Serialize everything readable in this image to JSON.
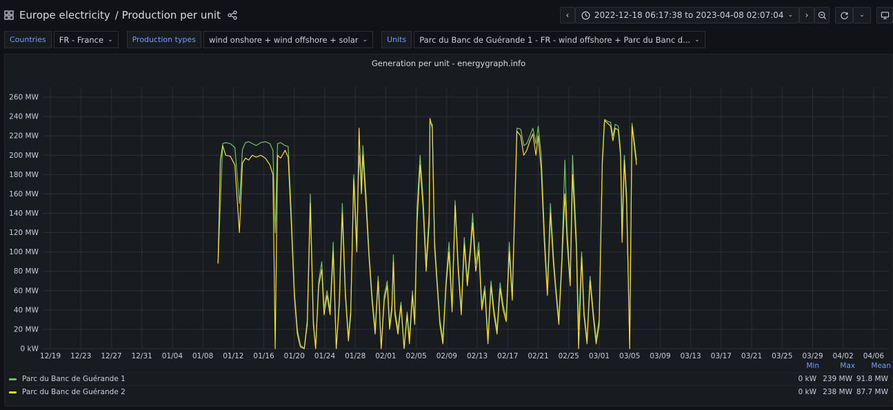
{
  "header": {
    "title": "Europe electricity",
    "subtitle": "/ Production per unit"
  },
  "time_picker": {
    "range": "2022-12-18 06:17:38 to 2023-04-08 02:07:04"
  },
  "variables": [
    {
      "label": "Countries",
      "value": "FR - France"
    },
    {
      "label": "Production types",
      "value": "wind onshore + wind offshore + solar"
    },
    {
      "label": "Units",
      "value": "Parc du Banc de Guérande 1 - FR - wind offshore + Parc du Banc d..."
    }
  ],
  "icons": {
    "grid": "dashboard-grid-icon",
    "share": "share-icon",
    "clock": "clock-icon",
    "zoom": "zoom-out-icon",
    "refresh": "refresh-icon",
    "monitor": "monitor-icon"
  },
  "colors": {
    "series1": "#73bf69",
    "series2": "#fade2a",
    "accent": "#6e9fff",
    "grid": "#2c2f36",
    "panel_bg": "#181b1f"
  },
  "chart_data": {
    "type": "line",
    "title": "Generation per unit - energygraph.info",
    "xlabel": "",
    "ylabel": "",
    "x_ticks": [
      "12/19",
      "12/23",
      "12/27",
      "12/31",
      "01/04",
      "01/08",
      "01/12",
      "01/16",
      "01/20",
      "01/24",
      "01/28",
      "02/01",
      "02/05",
      "02/09",
      "02/13",
      "02/17",
      "02/21",
      "02/25",
      "03/01",
      "03/05",
      "03/09",
      "03/13",
      "03/17",
      "03/21",
      "03/25",
      "03/29",
      "04/02",
      "04/06"
    ],
    "y_ticks": [
      "0 kW",
      "20 MW",
      "40 MW",
      "60 MW",
      "80 MW",
      "100 MW",
      "120 MW",
      "140 MW",
      "160 MW",
      "180 MW",
      "200 MW",
      "220 MW",
      "240 MW",
      "260 MW"
    ],
    "ylim": [
      0,
      270
    ],
    "x_range_days": [
      0,
      111
    ],
    "legend_columns": [
      "Min",
      "Max",
      "Mean"
    ],
    "grid": true,
    "legend_position": "bottom",
    "series": [
      {
        "name": "Parc du Banc de Guérande 1",
        "color": "#73bf69",
        "stats": {
          "min": "0 kW",
          "max": "239 MW",
          "mean": "91.8 MW"
        },
        "points": [
          [
            23.0,
            88
          ],
          [
            23.3,
            150
          ],
          [
            23.6,
            212
          ],
          [
            24.0,
            213
          ],
          [
            24.6,
            212
          ],
          [
            25.2,
            208
          ],
          [
            25.8,
            150
          ],
          [
            26.2,
            206
          ],
          [
            26.6,
            213
          ],
          [
            27.0,
            214
          ],
          [
            27.5,
            212
          ],
          [
            28.0,
            210
          ],
          [
            28.6,
            213
          ],
          [
            29.2,
            214
          ],
          [
            29.8,
            212
          ],
          [
            30.2,
            205
          ],
          [
            30.5,
            120
          ],
          [
            30.8,
            212
          ],
          [
            31.2,
            213
          ],
          [
            31.8,
            210
          ],
          [
            32.2,
            209
          ],
          [
            32.6,
            140
          ],
          [
            33.0,
            60
          ],
          [
            33.4,
            20
          ],
          [
            33.8,
            4
          ],
          [
            34.3,
            0
          ],
          [
            34.7,
            30
          ],
          [
            35.1,
            160
          ],
          [
            35.5,
            30
          ],
          [
            35.8,
            0
          ],
          [
            36.2,
            70
          ],
          [
            36.6,
            90
          ],
          [
            36.9,
            42
          ],
          [
            37.3,
            60
          ],
          [
            37.7,
            40
          ],
          [
            38.1,
            110
          ],
          [
            38.5,
            0
          ],
          [
            38.9,
            50
          ],
          [
            39.3,
            150
          ],
          [
            39.7,
            60
          ],
          [
            40.1,
            12
          ],
          [
            40.4,
            40
          ],
          [
            40.8,
            180
          ],
          [
            41.2,
            110
          ],
          [
            41.5,
            200
          ],
          [
            41.8,
            170
          ],
          [
            42.0,
            210
          ],
          [
            42.4,
            160
          ],
          [
            42.8,
            100
          ],
          [
            43.2,
            55
          ],
          [
            43.6,
            20
          ],
          [
            44.0,
            75
          ],
          [
            44.4,
            0
          ],
          [
            44.8,
            55
          ],
          [
            45.2,
            70
          ],
          [
            45.5,
            25
          ],
          [
            45.8,
            45
          ],
          [
            46.0,
            97
          ],
          [
            46.2,
            40
          ],
          [
            46.6,
            20
          ],
          [
            47.0,
            48
          ],
          [
            47.4,
            0
          ],
          [
            47.8,
            38
          ],
          [
            48.1,
            10
          ],
          [
            48.5,
            60
          ],
          [
            48.8,
            28
          ],
          [
            49.1,
            145
          ],
          [
            49.5,
            200
          ],
          [
            49.9,
            155
          ],
          [
            50.3,
            88
          ],
          [
            50.7,
            140
          ],
          [
            50.8,
            234
          ],
          [
            51.1,
            232
          ],
          [
            51.4,
            112
          ],
          [
            51.7,
            75
          ],
          [
            52.1,
            30
          ],
          [
            52.5,
            10
          ],
          [
            52.9,
            70
          ],
          [
            53.3,
            110
          ],
          [
            53.7,
            42
          ],
          [
            54.1,
            153
          ],
          [
            54.5,
            88
          ],
          [
            54.9,
            40
          ],
          [
            55.3,
            115
          ],
          [
            55.7,
            70
          ],
          [
            56.1,
            105
          ],
          [
            56.4,
            140
          ],
          [
            56.8,
            88
          ],
          [
            57.2,
            110
          ],
          [
            57.6,
            45
          ],
          [
            58.0,
            65
          ],
          [
            58.4,
            10
          ],
          [
            58.8,
            70
          ],
          [
            59.2,
            40
          ],
          [
            59.6,
            20
          ],
          [
            60.0,
            68
          ],
          [
            60.4,
            45
          ],
          [
            60.8,
            32
          ],
          [
            61.2,
            110
          ],
          [
            61.6,
            55
          ],
          [
            61.9,
            142
          ],
          [
            62.2,
            228
          ],
          [
            62.7,
            227
          ],
          [
            63.1,
            210
          ],
          [
            63.5,
            212
          ],
          [
            63.9,
            220
          ],
          [
            64.3,
            228
          ],
          [
            64.7,
            212
          ],
          [
            65.0,
            230
          ],
          [
            65.4,
            200
          ],
          [
            65.8,
            120
          ],
          [
            66.2,
            60
          ],
          [
            66.6,
            150
          ],
          [
            67.0,
            95
          ],
          [
            67.3,
            65
          ],
          [
            67.7,
            30
          ],
          [
            68.1,
            95
          ],
          [
            68.5,
            195
          ],
          [
            68.8,
            120
          ],
          [
            69.2,
            70
          ],
          [
            69.5,
            200
          ],
          [
            70.0,
            115
          ],
          [
            70.3,
            20
          ],
          [
            70.7,
            100
          ],
          [
            71.0,
            40
          ],
          [
            71.4,
            9
          ],
          [
            71.8,
            75
          ],
          [
            72.2,
            40
          ],
          [
            72.6,
            10
          ],
          [
            73.0,
            30
          ],
          [
            73.4,
            195
          ],
          [
            73.7,
            237
          ],
          [
            74.1,
            235
          ],
          [
            74.5,
            234
          ],
          [
            74.8,
            220
          ],
          [
            75.1,
            232
          ],
          [
            75.5,
            230
          ],
          [
            75.8,
            205
          ],
          [
            76.0,
            125
          ],
          [
            76.3,
            200
          ],
          [
            76.6,
            160
          ],
          [
            77.0,
            0
          ],
          [
            77.3,
            233
          ],
          [
            77.6,
            215
          ],
          [
            77.9,
            195
          ]
        ]
      },
      {
        "name": "Parc du Banc de Guérande 2",
        "color": "#fade2a",
        "stats": {
          "min": "0 kW",
          "max": "238 MW",
          "mean": "87.7 MW"
        },
        "points": [
          [
            23.0,
            88
          ],
          [
            23.3,
            195
          ],
          [
            23.6,
            210
          ],
          [
            24.0,
            200
          ],
          [
            24.6,
            199
          ],
          [
            25.2,
            190
          ],
          [
            25.8,
            120
          ],
          [
            26.2,
            192
          ],
          [
            26.6,
            197
          ],
          [
            27.0,
            195
          ],
          [
            27.5,
            200
          ],
          [
            28.0,
            198
          ],
          [
            28.6,
            200
          ],
          [
            29.2,
            197
          ],
          [
            29.8,
            190
          ],
          [
            30.2,
            180
          ],
          [
            30.5,
            0
          ],
          [
            30.8,
            200
          ],
          [
            31.2,
            197
          ],
          [
            31.8,
            205
          ],
          [
            32.2,
            198
          ],
          [
            32.6,
            130
          ],
          [
            33.0,
            55
          ],
          [
            33.4,
            15
          ],
          [
            33.8,
            2
          ],
          [
            34.3,
            0
          ],
          [
            34.7,
            25
          ],
          [
            35.1,
            150
          ],
          [
            35.5,
            25
          ],
          [
            35.8,
            0
          ],
          [
            36.2,
            65
          ],
          [
            36.6,
            82
          ],
          [
            36.9,
            35
          ],
          [
            37.3,
            55
          ],
          [
            37.7,
            35
          ],
          [
            38.1,
            100
          ],
          [
            38.5,
            0
          ],
          [
            38.9,
            45
          ],
          [
            39.3,
            140
          ],
          [
            39.7,
            55
          ],
          [
            40.1,
            8
          ],
          [
            40.4,
            35
          ],
          [
            40.8,
            175
          ],
          [
            41.2,
            100
          ],
          [
            41.5,
            228
          ],
          [
            41.8,
            160
          ],
          [
            42.0,
            200
          ],
          [
            42.4,
            150
          ],
          [
            42.8,
            95
          ],
          [
            43.2,
            50
          ],
          [
            43.6,
            15
          ],
          [
            44.0,
            70
          ],
          [
            44.4,
            0
          ],
          [
            44.8,
            50
          ],
          [
            45.2,
            65
          ],
          [
            45.5,
            20
          ],
          [
            45.8,
            40
          ],
          [
            46.0,
            90
          ],
          [
            46.2,
            35
          ],
          [
            46.6,
            15
          ],
          [
            47.0,
            45
          ],
          [
            47.4,
            0
          ],
          [
            47.8,
            35
          ],
          [
            48.1,
            5
          ],
          [
            48.5,
            55
          ],
          [
            48.8,
            25
          ],
          [
            49.1,
            130
          ],
          [
            49.5,
            190
          ],
          [
            49.9,
            145
          ],
          [
            50.3,
            80
          ],
          [
            50.7,
            130
          ],
          [
            50.8,
            238
          ],
          [
            51.1,
            228
          ],
          [
            51.4,
            105
          ],
          [
            51.7,
            70
          ],
          [
            52.1,
            25
          ],
          [
            52.5,
            5
          ],
          [
            52.9,
            65
          ],
          [
            53.3,
            100
          ],
          [
            53.7,
            38
          ],
          [
            54.1,
            148
          ],
          [
            54.5,
            82
          ],
          [
            54.9,
            35
          ],
          [
            55.3,
            108
          ],
          [
            55.7,
            65
          ],
          [
            56.1,
            100
          ],
          [
            56.4,
            130
          ],
          [
            56.8,
            80
          ],
          [
            57.2,
            102
          ],
          [
            57.6,
            40
          ],
          [
            58.0,
            60
          ],
          [
            58.4,
            5
          ],
          [
            58.8,
            65
          ],
          [
            59.2,
            35
          ],
          [
            59.6,
            15
          ],
          [
            60.0,
            62
          ],
          [
            60.4,
            40
          ],
          [
            60.8,
            28
          ],
          [
            61.2,
            100
          ],
          [
            61.6,
            50
          ],
          [
            61.9,
            135
          ],
          [
            62.2,
            225
          ],
          [
            62.7,
            220
          ],
          [
            63.1,
            200
          ],
          [
            63.5,
            205
          ],
          [
            63.9,
            215
          ],
          [
            64.3,
            222
          ],
          [
            64.7,
            200
          ],
          [
            65.0,
            220
          ],
          [
            65.4,
            185
          ],
          [
            65.8,
            110
          ],
          [
            66.2,
            55
          ],
          [
            66.6,
            140
          ],
          [
            67.0,
            88
          ],
          [
            67.3,
            60
          ],
          [
            67.7,
            25
          ],
          [
            68.1,
            88
          ],
          [
            68.5,
            160
          ],
          [
            68.8,
            110
          ],
          [
            69.2,
            65
          ],
          [
            69.5,
            180
          ],
          [
            70.0,
            105
          ],
          [
            70.3,
            0
          ],
          [
            70.7,
            95
          ],
          [
            71.0,
            35
          ],
          [
            71.4,
            5
          ],
          [
            71.8,
            70
          ],
          [
            72.2,
            35
          ],
          [
            72.6,
            5
          ],
          [
            73.0,
            25
          ],
          [
            73.4,
            190
          ],
          [
            73.7,
            236
          ],
          [
            74.1,
            233
          ],
          [
            74.5,
            230
          ],
          [
            74.8,
            215
          ],
          [
            75.1,
            228
          ],
          [
            75.5,
            226
          ],
          [
            75.8,
            200
          ],
          [
            76.0,
            110
          ],
          [
            76.3,
            195
          ],
          [
            76.6,
            150
          ],
          [
            77.0,
            0
          ],
          [
            77.3,
            230
          ],
          [
            77.6,
            210
          ],
          [
            77.9,
            190
          ]
        ]
      }
    ]
  }
}
